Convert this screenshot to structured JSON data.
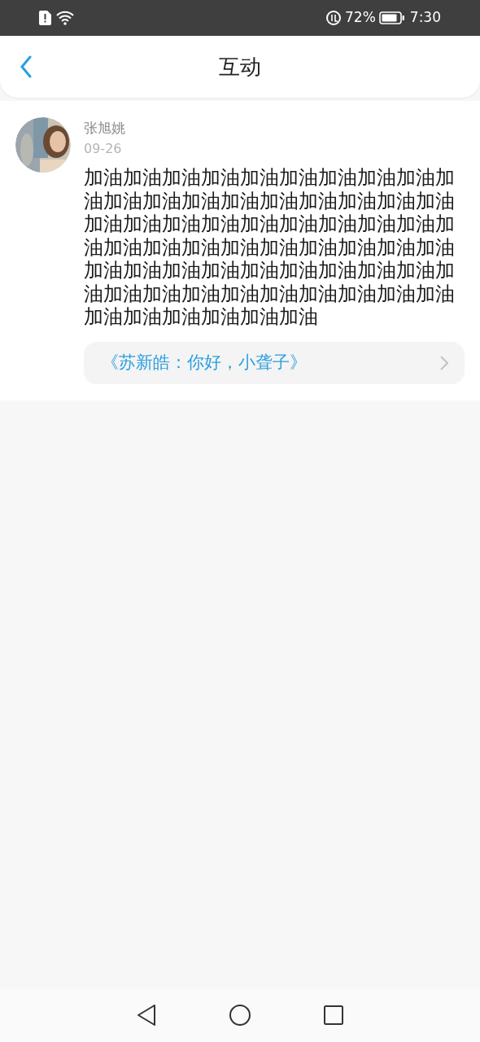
{
  "status_bar": {
    "battery": "72%",
    "time": "7:30"
  },
  "header": {
    "title": "互动"
  },
  "comments": [
    {
      "author": "张旭姚",
      "date": "09-26",
      "text": "加油加油加油加油加油加油加油加油加油加油加油加油加油加油加油加油加油加油加油加油加油加油加油加油加油加油加油加油加油加油加油加油加油加油加油加油加油加油加油加油加油加油加油加油加油加油加油加油加油加油加油加油加油加油加油加油加油加油加油加油加油加油加油",
      "link": "《苏新皓：你好，小聋子》"
    }
  ]
}
